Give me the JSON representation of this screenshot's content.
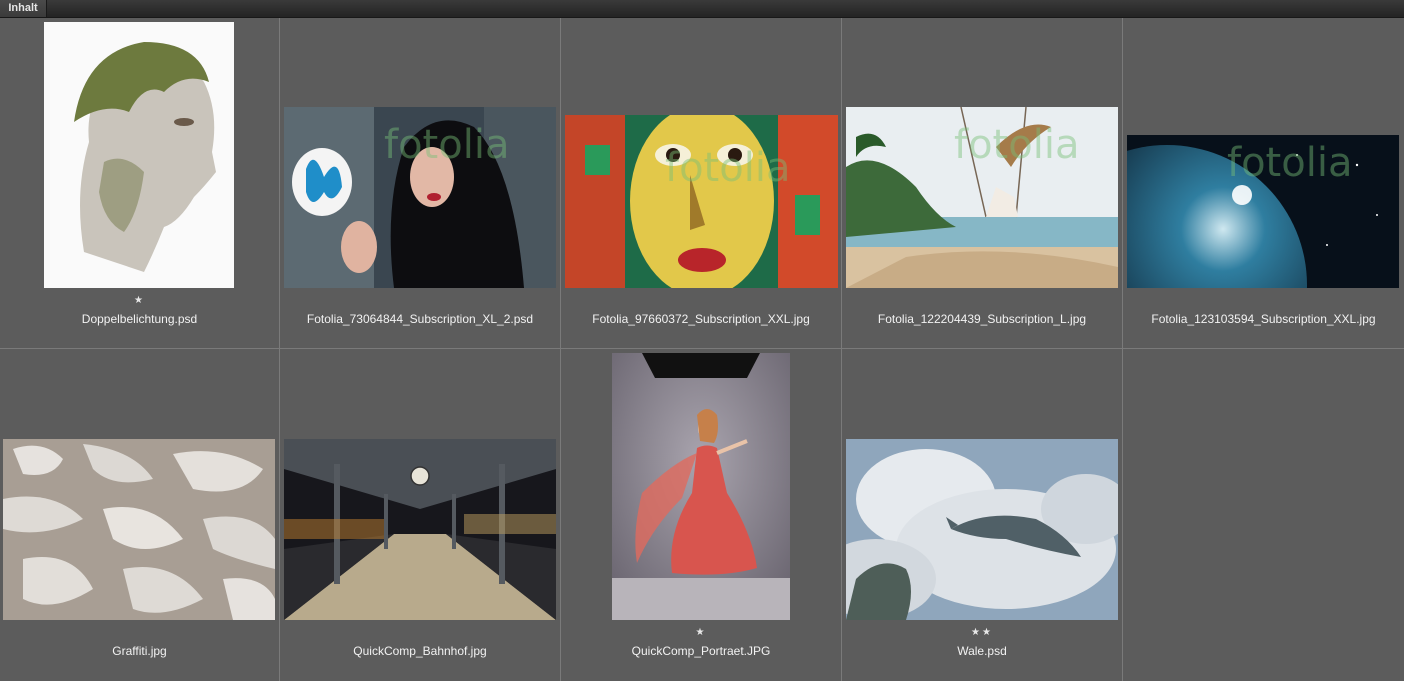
{
  "panel": {
    "tab_label": "Inhalt"
  },
  "watermark": "fotolia",
  "items": [
    {
      "filename": "Doppelbelichtung.psd",
      "stars": "★",
      "icon": "double-exposure-portrait"
    },
    {
      "filename": "Fotolia_73064844_Subscription_XL_2.psd",
      "stars": "",
      "icon": "woman-butterfly"
    },
    {
      "filename": "Fotolia_97660372_Subscription_XXL.jpg",
      "stars": "",
      "icon": "graffiti-face"
    },
    {
      "filename": "Fotolia_122204439_Subscription_L.jpg",
      "stars": "",
      "icon": "beach-swing"
    },
    {
      "filename": "Fotolia_123103594_Subscription_XXL.jpg",
      "stars": "",
      "icon": "planet-space"
    },
    {
      "filename": "Graffiti.jpg",
      "stars": "",
      "icon": "peeling-paint"
    },
    {
      "filename": "QuickComp_Bahnhof.jpg",
      "stars": "",
      "icon": "train-station"
    },
    {
      "filename": "QuickComp_Portraet.JPG",
      "stars": "★",
      "icon": "woman-red-dress"
    },
    {
      "filename": "Wale.psd",
      "stars": "★★",
      "icon": "whales-clouds"
    }
  ]
}
